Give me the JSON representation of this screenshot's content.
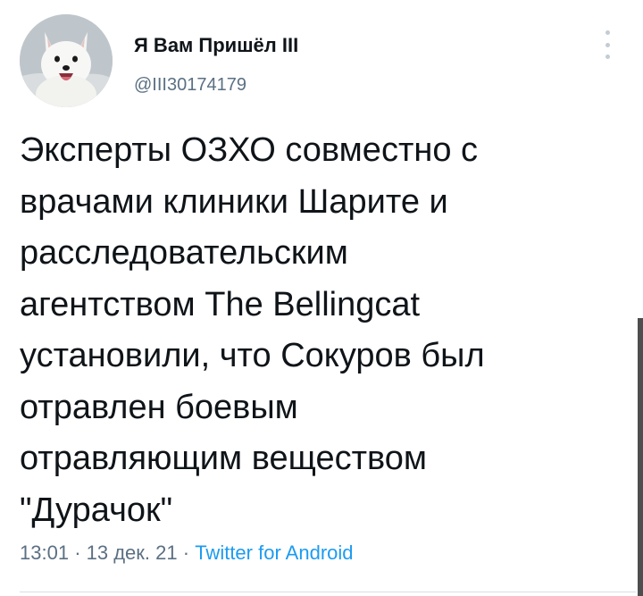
{
  "tweet": {
    "author": {
      "display_name": "Я Вам Пришёл III",
      "handle": "@III30174179",
      "avatar_icon": "arctic-fox-avatar"
    },
    "text": "Эксперты ОЗХО совместно с\nврачами клиники Шарите и\nрасследовательским\nагентством The Bellingcat\nустановили, что Сокуров был\nотравлен боевым\nотравляющим веществом\n\"Дурачок\"",
    "time": "13:01",
    "separator": "·",
    "date": "13 дек. 21",
    "source": "Twitter for Android"
  },
  "icons": {
    "more": "more-vertical-icon"
  },
  "colors": {
    "text": "#0f1419",
    "secondary": "#5b7083",
    "link": "#1d9bf0"
  }
}
